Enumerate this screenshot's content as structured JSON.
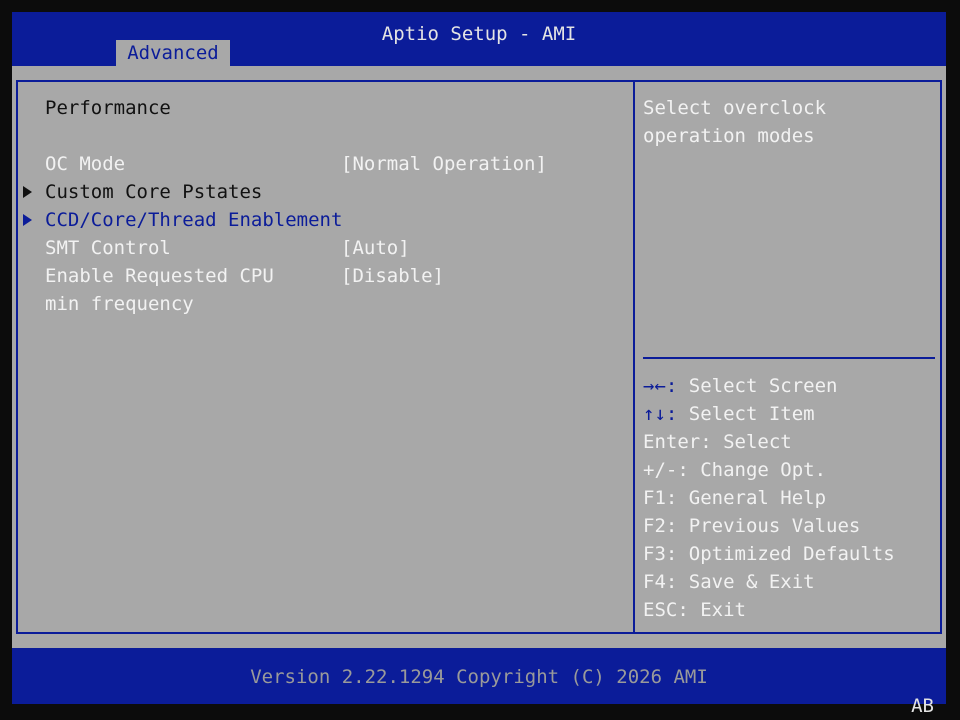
{
  "app": {
    "title": "Aptio Setup - AMI"
  },
  "tabs": [
    {
      "label": "Advanced",
      "active": true
    }
  ],
  "menu": {
    "heading": "Performance",
    "items": [
      {
        "label": "OC Mode",
        "value": "[Normal Operation]",
        "type": "option"
      },
      {
        "label": "Custom Core Pstates",
        "value": "",
        "type": "submenu"
      },
      {
        "label": "CCD/Core/Thread Enablement",
        "value": "",
        "type": "submenu",
        "selected": true
      },
      {
        "label": "SMT Control",
        "value": "[Auto]",
        "type": "option"
      },
      {
        "label": "Enable Requested CPU",
        "label_cont": "min frequency",
        "value": "[Disable]",
        "type": "option"
      }
    ]
  },
  "help": {
    "description": [
      "Select overclock",
      "operation modes"
    ],
    "keys": [
      {
        "key": "→←:",
        "action": "Select Screen"
      },
      {
        "key": "↑↓:",
        "action": "Select Item"
      },
      {
        "key": "Enter:",
        "action": "Select"
      },
      {
        "key": "+/-:",
        "action": "Change Opt."
      },
      {
        "key": "F1:",
        "action": "General Help"
      },
      {
        "key": "F2:",
        "action": "Previous Values"
      },
      {
        "key": "F3:",
        "action": "Optimized Defaults"
      },
      {
        "key": "F4:",
        "action": "Save & Exit"
      },
      {
        "key": "ESC:",
        "action": "Exit"
      }
    ]
  },
  "footer": {
    "version": "Version 2.22.1294 Copyright (C) 2026 AMI",
    "code": "AB"
  },
  "colors": {
    "header_blue": "#0b1c99",
    "panel_gray": "#a8a8a8",
    "text_white": "#f2f2f2",
    "text_black": "#111111"
  }
}
